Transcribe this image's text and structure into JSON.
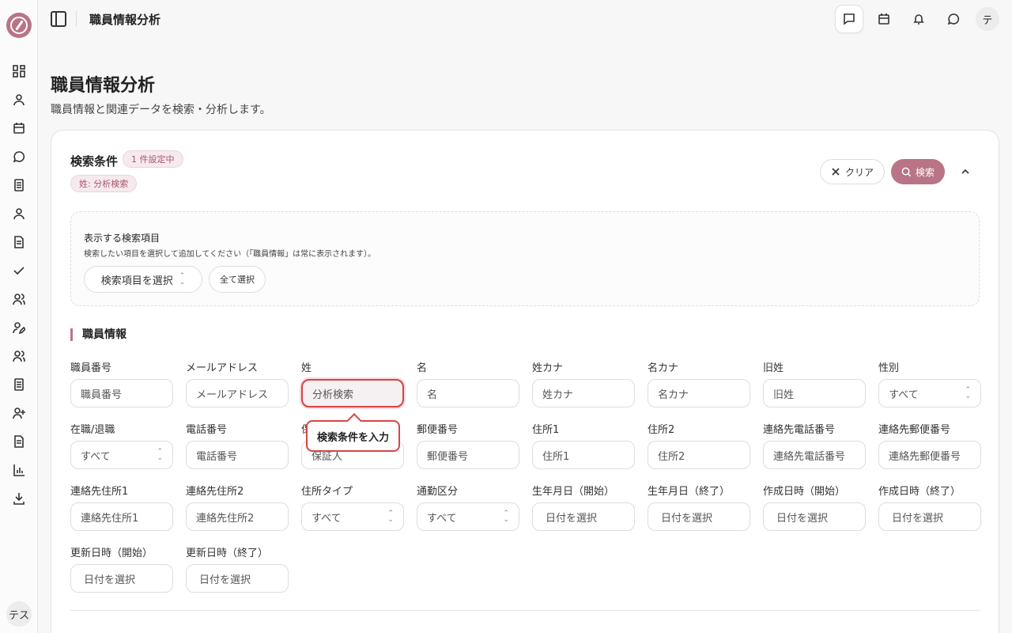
{
  "header": {
    "title": "職員情報分析",
    "avatar": "テ"
  },
  "sidebar": {
    "avatar": "テス"
  },
  "page": {
    "title": "職員情報分析",
    "description": "職員情報と関連データを検索・分析します。"
  },
  "search": {
    "title": "検索条件",
    "badge": "1 件設定中",
    "active_chip": "姓: 分析検索",
    "clear_label": "クリア",
    "search_label": "検索"
  },
  "fields_panel": {
    "title": "表示する検索項目",
    "description": "検索したい項目を選択して追加してください（「職員情報」は常に表示されます）。",
    "select_label": "検索項目を選択",
    "select_all_label": "全て選択"
  },
  "section": {
    "title": "職員情報"
  },
  "tooltip": "検索条件を入力",
  "fields": [
    {
      "label": "職員番号",
      "value": "職員番号",
      "kind": "text"
    },
    {
      "label": "メールアドレス",
      "value": "メールアドレス",
      "kind": "text"
    },
    {
      "label": "姓",
      "value": "分析検索",
      "kind": "focused"
    },
    {
      "label": "名",
      "value": "名",
      "kind": "text"
    },
    {
      "label": "姓カナ",
      "value": "姓カナ",
      "kind": "text"
    },
    {
      "label": "名カナ",
      "value": "名カナ",
      "kind": "text"
    },
    {
      "label": "旧姓",
      "value": "旧姓",
      "kind": "text"
    },
    {
      "label": "性別",
      "value": "すべて",
      "kind": "select"
    },
    {
      "label": "在職/退職",
      "value": "すべて",
      "kind": "select"
    },
    {
      "label": "電話番号",
      "value": "電話番号",
      "kind": "text"
    },
    {
      "label": "保",
      "value": "保証人",
      "kind": "text"
    },
    {
      "label": "郵便番号",
      "value": "郵便番号",
      "kind": "text"
    },
    {
      "label": "住所1",
      "value": "住所1",
      "kind": "text"
    },
    {
      "label": "住所2",
      "value": "住所2",
      "kind": "text"
    },
    {
      "label": "連絡先電話番号",
      "value": "連絡先電話番号",
      "kind": "text"
    },
    {
      "label": "連絡先郵便番号",
      "value": "連絡先郵便番号",
      "kind": "text"
    },
    {
      "label": "連絡先住所1",
      "value": "連絡先住所1",
      "kind": "text"
    },
    {
      "label": "連絡先住所2",
      "value": "連絡先住所2",
      "kind": "text"
    },
    {
      "label": "住所タイプ",
      "value": "すべて",
      "kind": "select"
    },
    {
      "label": "通勤区分",
      "value": "すべて",
      "kind": "select"
    },
    {
      "label": "生年月日（開始）",
      "value": "日付を選択",
      "kind": "date"
    },
    {
      "label": "生年月日（終了）",
      "value": "日付を選択",
      "kind": "date"
    },
    {
      "label": "作成日時（開始）",
      "value": "日付を選択",
      "kind": "date"
    },
    {
      "label": "作成日時（終了）",
      "value": "日付を選択",
      "kind": "date"
    },
    {
      "label": "更新日時（開始）",
      "value": "日付を選択",
      "kind": "date"
    },
    {
      "label": "更新日時（終了）",
      "value": "日付を選択",
      "kind": "date"
    }
  ]
}
